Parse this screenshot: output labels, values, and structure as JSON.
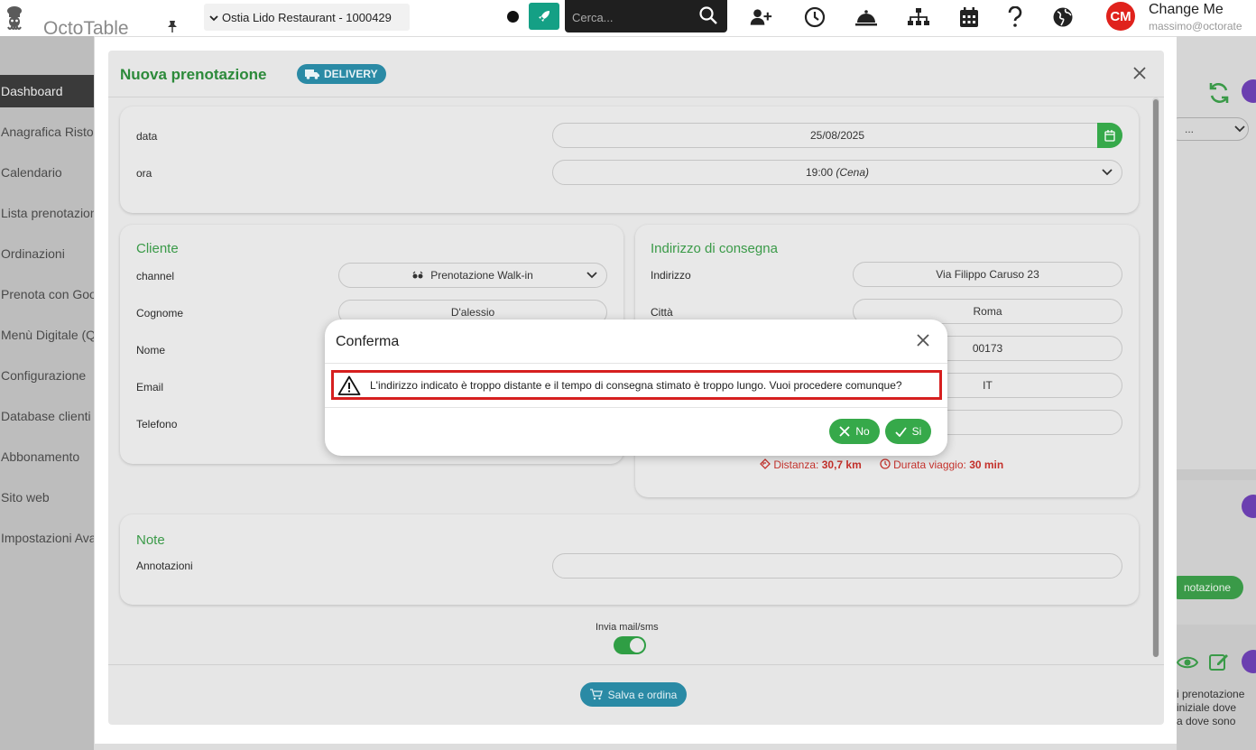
{
  "app": {
    "name": "OctoTable"
  },
  "topbar": {
    "venue": "Ostia Lido Restaurant - 1000429",
    "search_placeholder": "Cerca...",
    "user_initials": "CM",
    "user_name": "Change Me",
    "user_email": "massimo@octorate"
  },
  "sidebar": {
    "items": [
      {
        "label": "Dashboard",
        "active": true
      },
      {
        "label": "Anagrafica Ristorante"
      },
      {
        "label": "Calendario"
      },
      {
        "label": "Lista prenotazioni"
      },
      {
        "label": "Ordinazioni"
      },
      {
        "label": "Prenota con Google"
      },
      {
        "label": "Menù Digitale (QR)"
      },
      {
        "label": "Configurazione"
      },
      {
        "label": "Database clienti"
      },
      {
        "label": "Abbonamento"
      },
      {
        "label": "Sito web"
      },
      {
        "label": "Impostazioni Avanzate"
      }
    ]
  },
  "background_right": {
    "button_label": "notazione",
    "text_lines": [
      "i prenotazione",
      "iniziale dove",
      "a dove sono"
    ],
    "select_label": "..."
  },
  "modal": {
    "title": "Nuova prenotazione",
    "badge": "DELIVERY",
    "date": {
      "label": "data",
      "value": "25/08/2025"
    },
    "time": {
      "label": "ora",
      "value": "19:00",
      "value_note": "(Cena)"
    },
    "cliente": {
      "title": "Cliente",
      "channel_label": "channel",
      "channel_value": "Prenotazione Walk-in",
      "cognome_label": "Cognome",
      "cognome_value": "D'alessio",
      "nome_label": "Nome",
      "email_label": "Email",
      "telefono_label": "Telefono"
    },
    "indirizzo": {
      "title": "Indirizzo di consegna",
      "indirizzo_label": "Indirizzo",
      "indirizzo_value": "Via Filippo Caruso 23",
      "citta_label": "Città",
      "citta_value": "Roma",
      "cap_value": "00173",
      "paese_value": "IT",
      "distanza_label": "Distanza:",
      "distanza_value": "30,7 km",
      "durata_label": "Durata viaggio:",
      "durata_value": "30 min"
    },
    "note": {
      "title": "Note",
      "annotazioni_label": "Annotazioni"
    },
    "invia_label": "Invia mail/sms",
    "invia_on": true,
    "save_label": "Salva e ordina"
  },
  "confirm": {
    "title": "Conferma",
    "message": "L'indirizzo indicato è troppo distante e il tempo di consegna stimato è troppo lungo. Vuoi procedere comunque?",
    "no_label": "No",
    "si_label": "Si"
  },
  "colors": {
    "green": "#36a94a",
    "teal": "#2a8aa5",
    "warning_red": "#d61f1f",
    "avatar_red": "#e0221c"
  },
  "icons": [
    "pin-icon",
    "rocket-icon",
    "search-icon",
    "add-user-icon",
    "clock-icon",
    "bell-icon",
    "sitemap-icon",
    "calendar-icon",
    "help-icon",
    "globe-icon",
    "truck-icon",
    "close-icon",
    "chevron-down-icon",
    "warning-icon",
    "check-icon",
    "cart-icon",
    "refresh-icon",
    "eye-icon",
    "edit-icon"
  ]
}
